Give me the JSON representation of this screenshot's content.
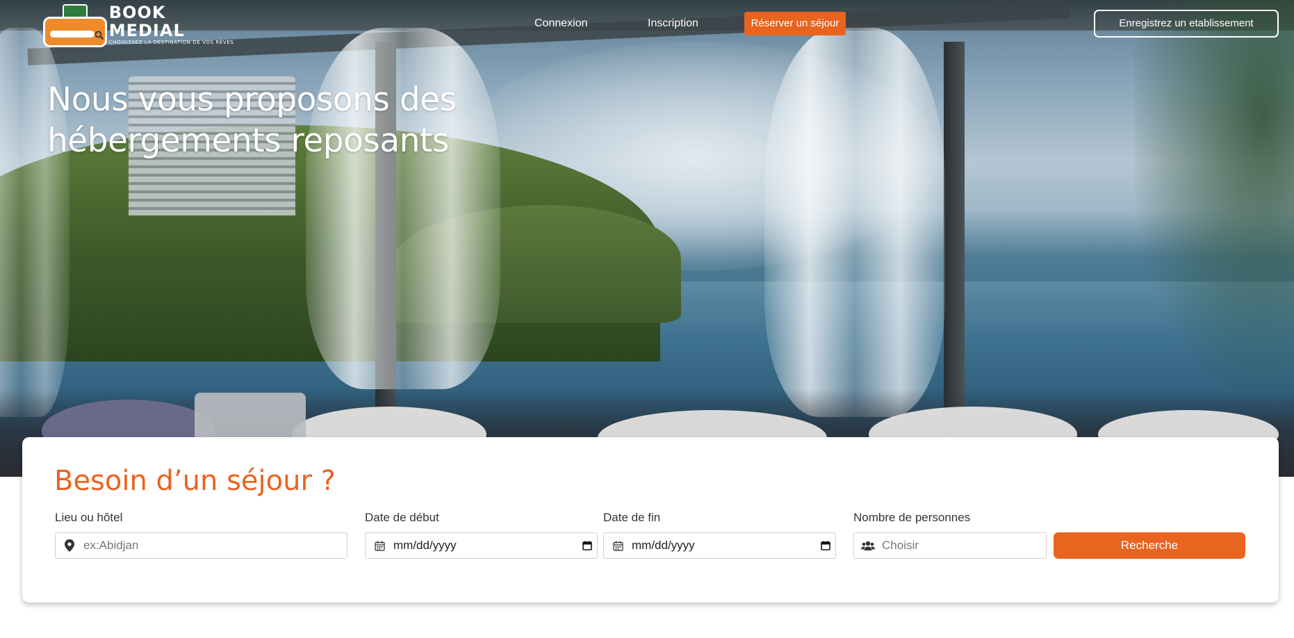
{
  "brand": {
    "name": "BOOK MEDIAL",
    "tagline": "CHOISISSEZ LA DESTINATION DE VOS RÊVES",
    "accent_color": "#e8641f",
    "logo_orange": "#ee8a2a",
    "logo_green": "#2e7d3c"
  },
  "nav": {
    "login_label": "Connexion",
    "signup_label": "Inscription",
    "book_label": "Réserver un séjour",
    "register_label": "Enregistrez un etablissement"
  },
  "hero": {
    "title_line1": "Nous vous proposons des",
    "title_line2": "hébergements reposants"
  },
  "search": {
    "title": "Besoin d’un séjour ?",
    "location": {
      "label": "Lieu ou hôtel",
      "placeholder": "ex:Abidjan",
      "icon": "map-marker-icon"
    },
    "start_date": {
      "label": "Date de début",
      "value": "mm/dd/yyyy",
      "icon": "calendar-icon"
    },
    "end_date": {
      "label": "Date de fin",
      "value": "mm/dd/yyyy",
      "icon": "calendar-icon"
    },
    "guests": {
      "label": "Nombre de personnes",
      "placeholder": "Choisir",
      "icon": "users-icon"
    },
    "submit_label": "Recherche"
  }
}
